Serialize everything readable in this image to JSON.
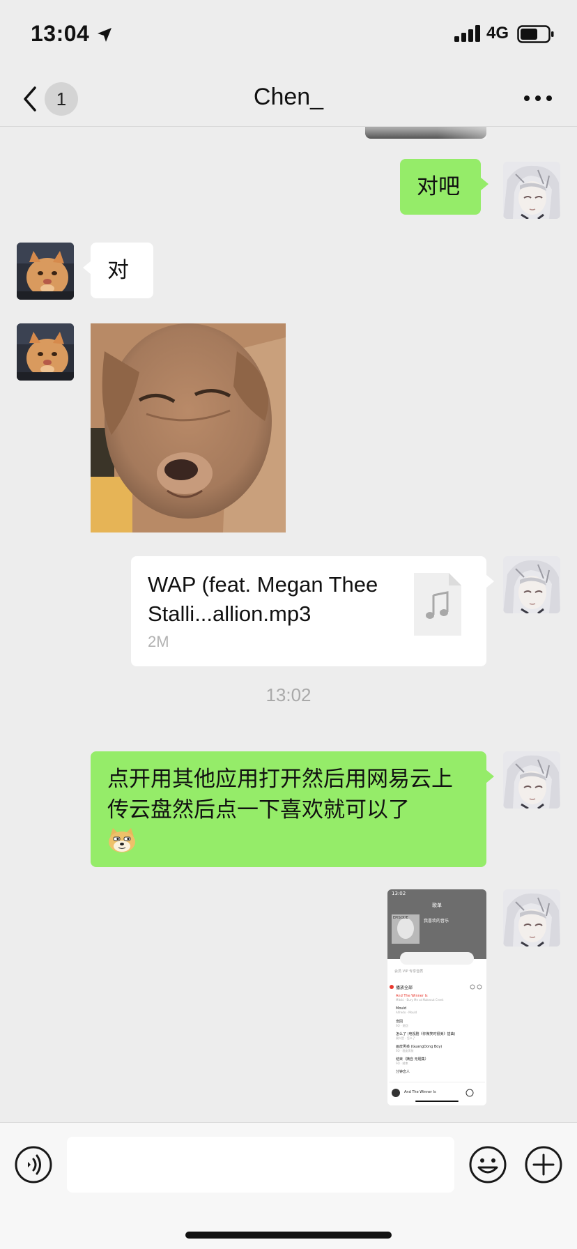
{
  "status_bar": {
    "time": "13:04",
    "network": "4G"
  },
  "nav": {
    "unread_count": "1",
    "title": "Chen_"
  },
  "messages": {
    "m1": "对吧",
    "m2": "对",
    "file": {
      "name": "WAP (feat. Megan Thee Stalli...allion.mp3",
      "size": "2M"
    },
    "timestamp": "13:02",
    "m5": "点开用其他应用打开然后用网易云上传云盘然后点一下喜欢就可以了"
  },
  "screenshot_thumb": {
    "time": "13:02",
    "header": "歌单",
    "album_title": "我喜欢的音乐",
    "cover_text": "EPISODE",
    "vip_bar": "会员 VIP 专享音质",
    "play_all": "播放全部",
    "rows": [
      {
        "title": "And The Winner Is",
        "sub": "Mitski · Bury Me at Makeout Creek"
      },
      {
        "title": "Mould",
        "sub": "Alfredo · Mould"
      },
      {
        "title": "宠回",
        "sub": "SQ · 宠回"
      },
      {
        "title": "怎么了 (电视剧《你微笑时很美》插曲)",
        "sub": "周兴哲 · 怎么了"
      },
      {
        "title": "画皮男孩 (GuangDong Boy)",
        "sub": "SQ · 画皮男孩"
      },
      {
        "title": "结束（摘自 无题集）",
        "sub": "SQ · 结束"
      },
      {
        "title": "分钟恋人",
        "sub": ""
      }
    ],
    "now_playing": "And The Winner Is"
  },
  "colors": {
    "green_bubble": "#95ec69",
    "background": "#ededed",
    "accent_red": "#e8382e"
  }
}
